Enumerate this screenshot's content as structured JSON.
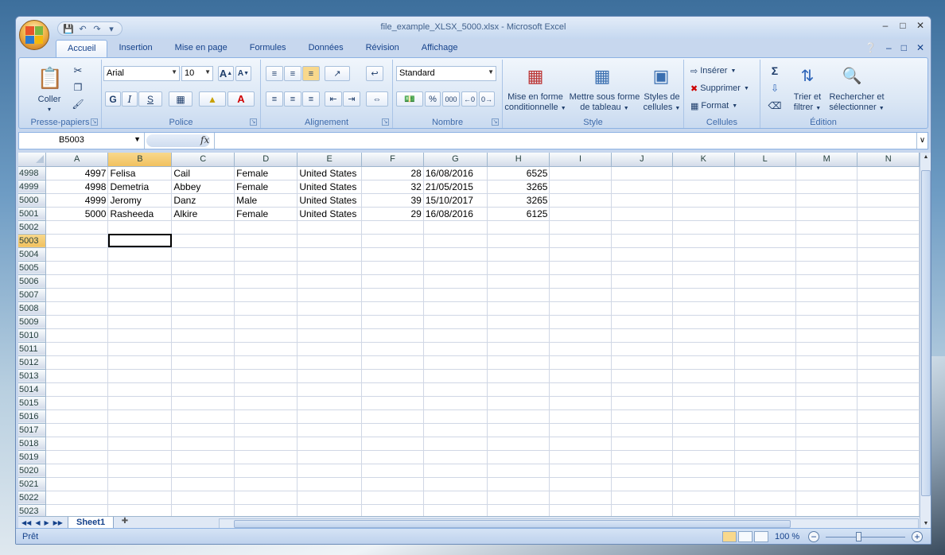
{
  "window": {
    "title": "file_example_XLSX_5000.xlsx - Microsoft Excel",
    "controls": [
      "–",
      "□",
      "✕"
    ],
    "inner_controls": [
      "–",
      "□",
      "✕"
    ]
  },
  "ribbon_tabs": [
    "Accueil",
    "Insertion",
    "Mise en page",
    "Formules",
    "Données",
    "Révision",
    "Affichage"
  ],
  "groups": {
    "clipboard": {
      "label": "Presse-papiers",
      "paste": "Coller"
    },
    "font": {
      "label": "Police",
      "font_name": "Arial",
      "font_size": "10",
      "bold": "G",
      "italic": "I",
      "underline": "S"
    },
    "alignment": {
      "label": "Alignement"
    },
    "number": {
      "label": "Nombre",
      "format": "Standard",
      "percent": "%",
      "thousands": "000"
    },
    "style": {
      "label": "Style",
      "cond_format": "Mise en forme",
      "cond_format2": "conditionnelle",
      "table_format": "Mettre sous forme",
      "table_format2": "de tableau",
      "cell_styles": "Styles de",
      "cell_styles2": "cellules"
    },
    "cells": {
      "label": "Cellules",
      "insert": "Insérer",
      "delete": "Supprimer",
      "format": "Format"
    },
    "editing": {
      "label": "Édition",
      "sort": "Trier et",
      "sort2": "filtrer",
      "find": "Rechercher et",
      "find2": "sélectionner"
    }
  },
  "formula_bar": {
    "name_box": "B5003",
    "fx": "fx",
    "formula": ""
  },
  "columns": [
    "A",
    "B",
    "C",
    "D",
    "E",
    "F",
    "G",
    "H",
    "I",
    "J",
    "K",
    "L",
    "M",
    "N"
  ],
  "rows": [
    {
      "n": "4998",
      "cells": [
        "4997",
        "Felisa",
        "Cail",
        "Female",
        "United States",
        "28",
        "16/08/2016",
        "6525"
      ]
    },
    {
      "n": "4999",
      "cells": [
        "4998",
        "Demetria",
        "Abbey",
        "Female",
        "United States",
        "32",
        "21/05/2015",
        "3265"
      ]
    },
    {
      "n": "5000",
      "cells": [
        "4999",
        "Jeromy",
        "Danz",
        "Male",
        "United States",
        "39",
        "15/10/2017",
        "3265"
      ]
    },
    {
      "n": "5001",
      "cells": [
        "5000",
        "Rasheeda",
        "Alkire",
        "Female",
        "United States",
        "29",
        "16/08/2016",
        "6125"
      ]
    },
    {
      "n": "5002",
      "cells": []
    },
    {
      "n": "5003",
      "cells": []
    },
    {
      "n": "5004",
      "cells": []
    },
    {
      "n": "5005",
      "cells": []
    },
    {
      "n": "5006",
      "cells": []
    },
    {
      "n": "5007",
      "cells": []
    },
    {
      "n": "5008",
      "cells": []
    },
    {
      "n": "5009",
      "cells": []
    },
    {
      "n": "5010",
      "cells": []
    },
    {
      "n": "5011",
      "cells": []
    },
    {
      "n": "5012",
      "cells": []
    },
    {
      "n": "5013",
      "cells": []
    },
    {
      "n": "5014",
      "cells": []
    },
    {
      "n": "5015",
      "cells": []
    },
    {
      "n": "5016",
      "cells": []
    },
    {
      "n": "5017",
      "cells": []
    },
    {
      "n": "5018",
      "cells": []
    },
    {
      "n": "5019",
      "cells": []
    },
    {
      "n": "5020",
      "cells": []
    },
    {
      "n": "5021",
      "cells": []
    },
    {
      "n": "5022",
      "cells": []
    },
    {
      "n": "5023",
      "cells": []
    }
  ],
  "selected_row": "5003",
  "selected_col": "B",
  "sheet_tabs": [
    "Sheet1"
  ],
  "status": {
    "text": "Prêt",
    "zoom": "100 %"
  }
}
